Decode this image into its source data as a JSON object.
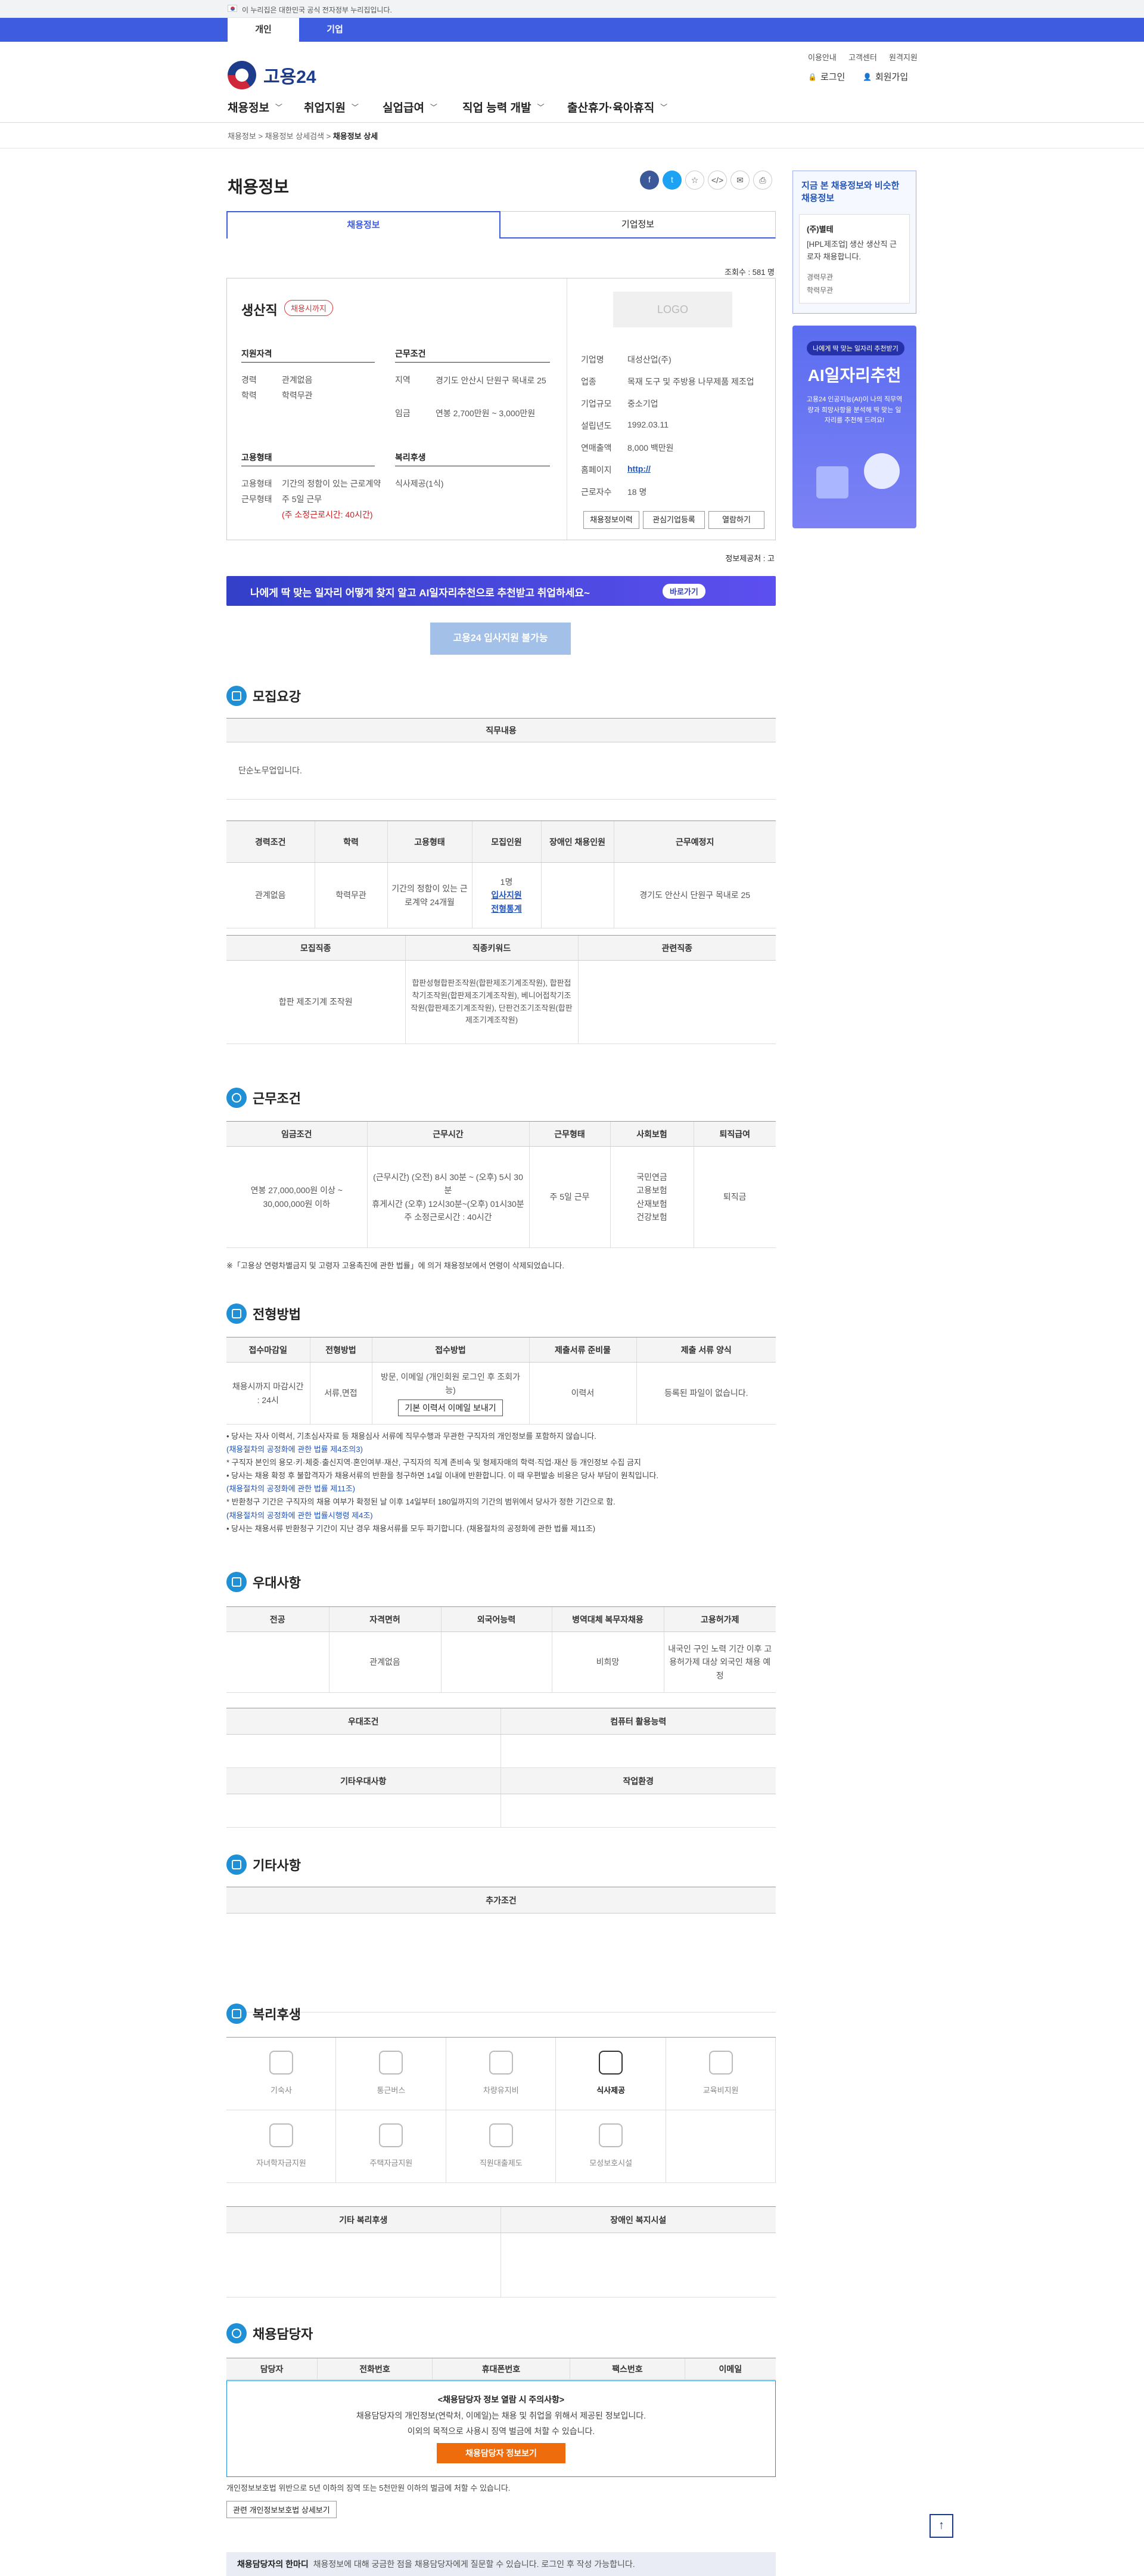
{
  "gov_notice": "이 누리집은 대한민국 공식 전자정부 누리집입니다.",
  "user_tabs": [
    "개인",
    "기업"
  ],
  "logo": "고용24",
  "util_links": [
    "이용안내",
    "고객센터",
    "원격지원"
  ],
  "user_menu": {
    "login": "로그인",
    "join": "회원가입"
  },
  "gnb": [
    "채용정보",
    "취업지원",
    "실업급여",
    "직업 능력 개발",
    "출산휴가·육아휴직"
  ],
  "breadcrumb": {
    "a": "채용정보",
    "b": "채용정보 상세검색",
    "c": "채용정보 상세"
  },
  "page_title": "채용정보",
  "tabs": [
    "채용정보",
    "기업정보"
  ],
  "hits": "조회수 : 581 명",
  "summary": {
    "company": "생산직",
    "badge": "채용시까지",
    "req_title": "지원자격",
    "req_k1": "경력",
    "req_v1": "관계없음",
    "req_k2": "학력",
    "req_v2": "학력무관",
    "cond_title": "근무조건",
    "cond_k1": "지역",
    "cond_v1": "경기도 안산시 단원구 목내로 25",
    "cond_k2": "임금",
    "cond_v2": "연봉 2,700만원 ~ 3,000만원",
    "emp_title": "고용형태",
    "emp_k1": "고용형태",
    "emp_v1": "기간의 정함이 있는 근로계약",
    "emp_k2": "근무형태",
    "emp_v2": "주 5일 근무",
    "emp_v3": "(주 소정근로시간: 40시간)",
    "wel_title": "복리후생",
    "wel_v1": "식사제공(1식)"
  },
  "company_info": {
    "logo": "LOGO",
    "rows": [
      [
        "기업명",
        "대성산업(주)"
      ],
      [
        "업종",
        "목재 도구 및 주방용 나무제품 제조업"
      ],
      [
        "기업규모",
        "중소기업"
      ],
      [
        "설립년도",
        "1992.03.11"
      ],
      [
        "연매출액",
        "8,000 백만원"
      ],
      [
        "홈페이지",
        "http://"
      ],
      [
        "근로자수",
        "18 명"
      ]
    ],
    "btns": [
      "채용정보이력",
      "관심기업등록",
      "열람하기"
    ]
  },
  "info_date": "정보제공처 : 고",
  "ad_text": "나에게 딱 맞는 일자리 어떻게 찾지 알고  AI일자리추천으로 추천받고 취업하세요~",
  "ad_btn": "바로가기",
  "apply_btn": "고용24 입사지원 불가능",
  "sec1": {
    "title": "모집요강",
    "job_head": "직무내용",
    "job_text": "단순노무업입니다.",
    "t1_heads": [
      "경력조건",
      "학력",
      "고용형태",
      "모집인원",
      "장애인 채용인원",
      "근무예정지"
    ],
    "t1_row": [
      "관계없음",
      "학력무관",
      "기간의 정함이 있는 근로계약 24개월",
      "1명",
      "",
      "경기도 안산시 단원구 목내로 25"
    ],
    "link1": "입사지원",
    "link2": "전형통계",
    "t2_heads": [
      "모집직종",
      "직종키워드",
      "관련직종"
    ],
    "t2_row": [
      "합판 제조기계 조작원",
      "합판성형합판조작원(합판제조기계조작원), 합판접착기조작원(합판제조기계조작원), 베니어접착기조작원(합판제조기계조작원), 단판건조기조작원(합판제조기계조작원)",
      ""
    ]
  },
  "sec2": {
    "title": "근무조건",
    "heads": [
      "임금조건",
      "근무시간",
      "근무형태",
      "사회보험",
      "퇴직급여"
    ],
    "wage": "연봉 27,000,000원 이상 ~ 30,000,000원 이하",
    "hours": "(근무시간) (오전) 8시 30분 ~ (오후) 5시 30분",
    "rest": "휴게시간 (오후) 12시30분~(오후) 01시30분",
    "week": "주 소정근로시간 : 40시간",
    "type": "주 5일 근무",
    "insurance": [
      "국민연금",
      "고용보험",
      "산재보험",
      "건강보험"
    ],
    "retire": "퇴직금",
    "note": "※「고용상 연령차별금지 및 고령자 고용촉진에 관한 법률」에 의거 채용정보에서 연령이 삭제되었습니다."
  },
  "sec3": {
    "title": "전형방법",
    "heads": [
      "접수마감일",
      "전형방법",
      "접수방법",
      "제출서류 준비물",
      "제출 서류 양식"
    ],
    "row": [
      "채용시까지 마감시간 : 24시",
      "서류,면접",
      "방문, 이메일 (개인회원 로그인 후 조회가능)",
      "이력서",
      "등록된 파일이 없습니다."
    ],
    "mail_btn": "기본 이력서 이메일 보내기",
    "notes": [
      "• 당사는 자사 이력서, 기초심사자료 등 채용심사 서류에 직무수행과 무관한 구직자의 개인정보를 포함하지 않습니다.",
      "(채용절차의 공정화에 관한 법률 제4조의3)",
      "* 구직자 본인의 용모·키·체중·출신지역·혼인여부·재산, 구직자의 직계 존비속 및 형제자매의 학력·직업·재산 등 개인정보 수집 금지",
      "• 당사는 채용 확정 후 불합격자가 채용서류의 반환을 청구하면 14일 이내에 반환합니다. 이 때 우편발송 비용은 당사 부담이 원칙입니다.",
      "(채용절차의 공정화에 관한 법률 제11조)",
      "* 반환청구 기간은 구직자의 채용 여부가 확정된 날 이후 14일부터 180일까지의 기간의 범위에서 당사가 정한 기간으로 함.",
      "(채용절차의 공정화에 관한 법률시행령 제4조)",
      "• 당사는 채용서류 반환청구 기간이 지난 경우 채용서류를 모두 파기합니다. (채용절차의 공정화에 관한 법률 제11조)"
    ]
  },
  "sec4": {
    "title": "우대사항",
    "heads": [
      "전공",
      "자격면허",
      "외국어능력",
      "병역대체 복무자채용",
      "고용허가제"
    ],
    "row": [
      "",
      "관계없음",
      "",
      "비희망",
      "내국인 구인 노력 기간 이후 고용허가제 대상 외국인 채용 예정"
    ],
    "h2": [
      "우대조건",
      "컴퓨터 활용능력"
    ],
    "h3": [
      "기타우대사항",
      "작업환경"
    ]
  },
  "sec5": {
    "title": "기타사항",
    "head": "추가조건"
  },
  "sec6": {
    "title": "복리후생",
    "items": [
      "기숙사",
      "통근버스",
      "차량유지비",
      "식사제공",
      "교육비지원",
      "자녀학자금지원",
      "주택자금지원",
      "직원대출제도",
      "모성보호시설",
      ""
    ],
    "active": 3,
    "heads": [
      "기타 복리후생",
      "장애인 복지시설"
    ]
  },
  "sec7": {
    "title": "채용담당자",
    "heads": [
      "담당자",
      "전화번호",
      "휴대폰번호",
      "팩스번호",
      "이메일"
    ],
    "notice_title": "<채용담당자 정보 열람 시 주의사항>",
    "notice1": "채용담당자의 개인정보(연락처, 이메일)는 채용 및 취업을 위해서 제공된 정보입니다.",
    "notice2": "이외의 목적으로 사용시 징역 벌금에 처할 수 있습니다.",
    "view_btn": "채용담당자 정보보기",
    "law": "개인정보보호법 위반으로 5년 이하의 징역 또는 5천만원 이하의 벌금에 처할 수 있습니다.",
    "law_btn": "관련 개인정보보호법 상세보기"
  },
  "footer_bar": {
    "title": "채용담당자의 한마디",
    "text": "채용정보에 대해 궁금한 점을 채용담당자에게 질문할 수 있습니다. 로그인 후 작성 가능합니다."
  },
  "side": {
    "title": "지금 본 채용정보와 비슷한 채용정보",
    "company": "(주)별테",
    "desc": "[HPL제조업] 생산 생산직 근로자 채용합니다.",
    "k1": "경력무관",
    "k2": "학력무관"
  },
  "banner": {
    "tag": "나에게 딱 맞는 일자리 추천받기",
    "title": "AI일자리추천",
    "desc": "고용24 인공지능(AI)이 나의 직무역량과 희망사항을 분석해 딱 맞는 일자리를 추천해 드려요!"
  }
}
